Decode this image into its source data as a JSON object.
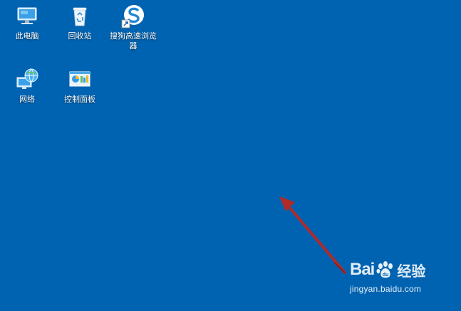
{
  "desktop": {
    "background_color": "#0063b1",
    "icons": [
      {
        "label": "此电脑",
        "icon": "computer-icon"
      },
      {
        "label": "回收站",
        "icon": "recycle-bin-icon"
      },
      {
        "label": "搜狗高速浏览器",
        "icon": "sogou-browser-icon"
      },
      {
        "label": "网络",
        "icon": "network-icon"
      },
      {
        "label": "控制面板",
        "icon": "control-panel-icon"
      }
    ]
  },
  "annotation": {
    "arrow_color": "#b02a2a",
    "icon": "red-arrow-icon"
  },
  "watermark": {
    "brand_bai": "Bai",
    "brand_jingyan": "经验",
    "url": "jingyan.baidu.com"
  }
}
